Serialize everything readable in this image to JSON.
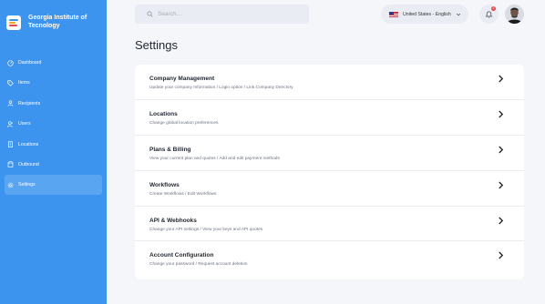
{
  "brand": {
    "name": "Georgia Institute of Tecnology"
  },
  "sidebar": {
    "items": [
      {
        "label": "Dashboard",
        "icon": "dashboard-icon"
      },
      {
        "label": "Items",
        "icon": "tag-icon"
      },
      {
        "label": "Recipients",
        "icon": "user-icon"
      },
      {
        "label": "Users",
        "icon": "users-icon"
      },
      {
        "label": "Locations",
        "icon": "building-icon"
      },
      {
        "label": "Outbound",
        "icon": "box-icon"
      },
      {
        "label": "Settings",
        "icon": "gear-icon",
        "active": true
      }
    ]
  },
  "search": {
    "placeholder": "Search..."
  },
  "language": {
    "label": "United States - English"
  },
  "notifications": {
    "count": "2"
  },
  "page": {
    "title": "Settings"
  },
  "settings": [
    {
      "title": "Company Management",
      "description": "Update your company Information / Login option / Link Company Directory"
    },
    {
      "title": "Locations",
      "description": "Change global location preferences"
    },
    {
      "title": "Plans & Billing",
      "description": "View your current plan and quotes / Add and edit payment methods"
    },
    {
      "title": "Workflows",
      "description": "Create Workflows / Edit Workflows"
    },
    {
      "title": "API & Webhooks",
      "description": "Change your API settings / View your keys and API quotes"
    },
    {
      "title": "Account Configuration",
      "description": "Change your password / Request account deletion"
    }
  ],
  "colors": {
    "sidebar": "#3d94ee",
    "active": "#5aa5f1",
    "background": "#f4f6f9"
  }
}
